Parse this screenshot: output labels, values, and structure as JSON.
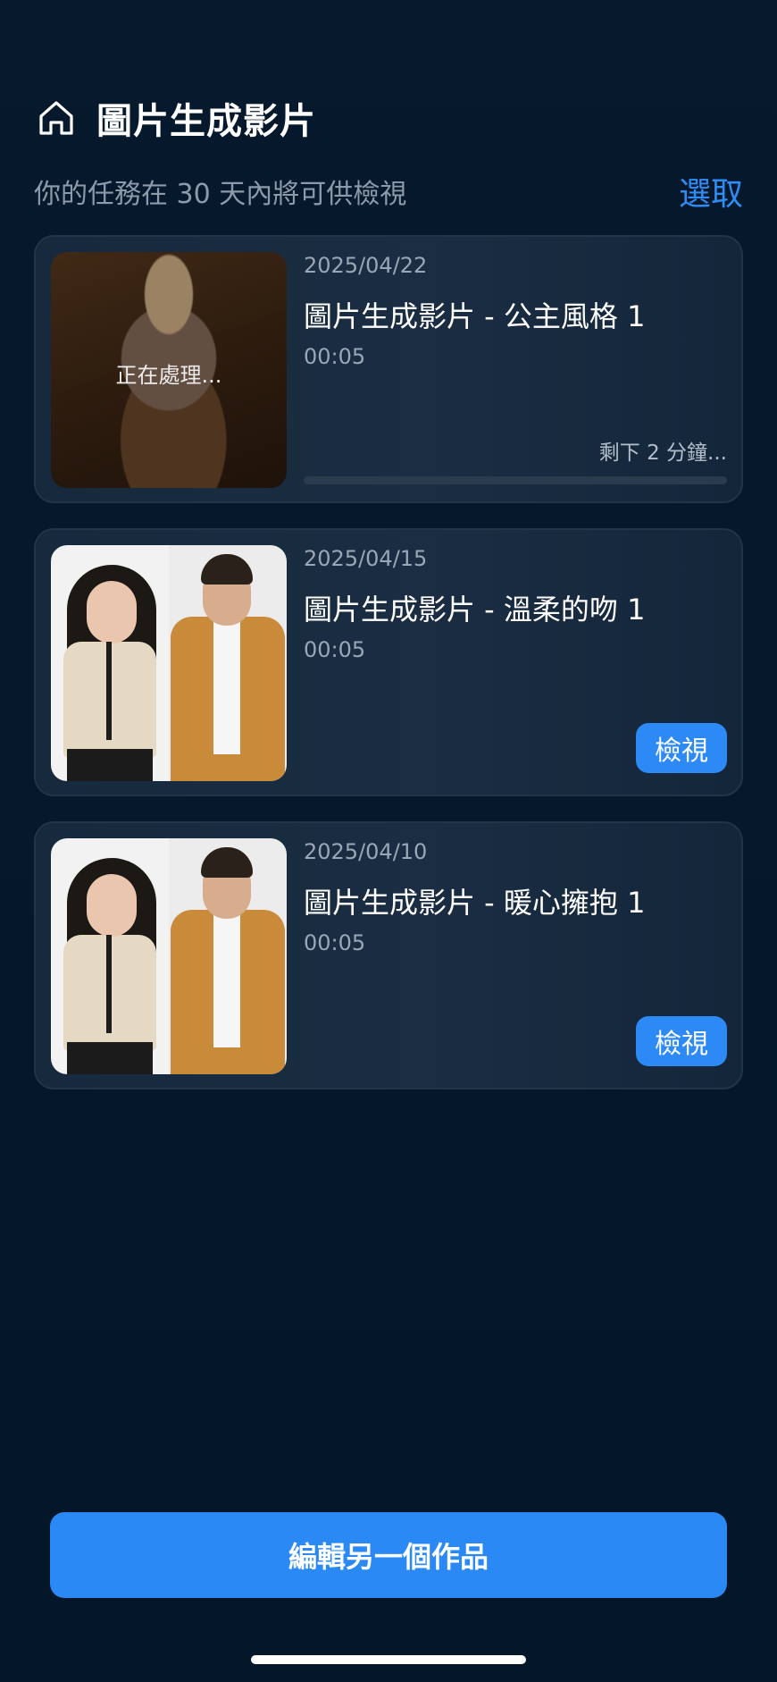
{
  "header": {
    "home_icon": "home-icon",
    "title": "圖片生成影片"
  },
  "subtitle": "你的任務在 30 天內將可供檢視",
  "select_label": "選取",
  "tasks": [
    {
      "date": "2025/04/22",
      "title": "圖片生成影片 - 公主風格 1",
      "duration": "00:05",
      "status": "processing",
      "thumbnail_overlay": "正在處理...",
      "remaining": "剩下 2 分鐘...",
      "progress": 0
    },
    {
      "date": "2025/04/15",
      "title": "圖片生成影片 - 溫柔的吻 1",
      "duration": "00:05",
      "status": "done",
      "view_label": "檢視"
    },
    {
      "date": "2025/04/10",
      "title": "圖片生成影片 - 暖心擁抱 1",
      "duration": "00:05",
      "status": "done",
      "view_label": "檢視"
    }
  ],
  "primary_button": "編輯另一個作品",
  "colors": {
    "background": "#06182b",
    "accent": "#2d89f6",
    "card_border": "#243447",
    "muted_text": "#8d9aa9"
  }
}
